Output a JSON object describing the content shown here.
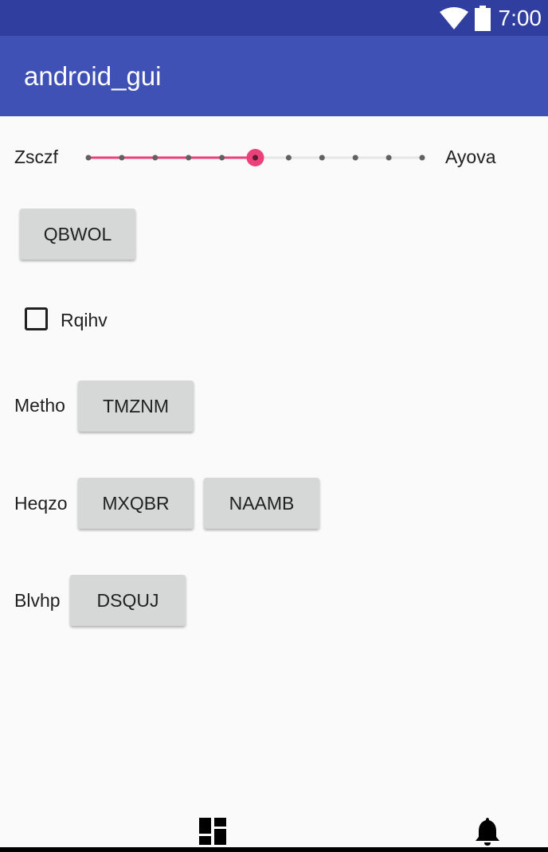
{
  "status_bar": {
    "time": "7:00",
    "icons": [
      "wifi-icon",
      "battery-icon"
    ]
  },
  "app_bar": {
    "title": "android_gui"
  },
  "slider": {
    "min_label": "Zsczf",
    "max_label": "Ayova",
    "steps": 10,
    "value": 5,
    "accent_color": "#ec407a"
  },
  "buttons": {
    "qbwol": "QBWOL",
    "tmznm": "TMZNM",
    "mxqbr": "MXQBR",
    "naamb": "NAAMB",
    "dsquj": "DSQUJ"
  },
  "checkbox": {
    "label": "Rqihv",
    "checked": false
  },
  "rows": {
    "metho_label": "Metho",
    "heqzo_label": "Heqzo",
    "blvhp_label": "Blvhp"
  },
  "bottom_nav": {
    "icons": [
      "dashboard-icon",
      "bell-icon"
    ]
  },
  "colors": {
    "status_bar": "#303f9f",
    "app_bar": "#3f51b5",
    "button_bg": "#d6d7d7",
    "background": "#fafafa"
  }
}
